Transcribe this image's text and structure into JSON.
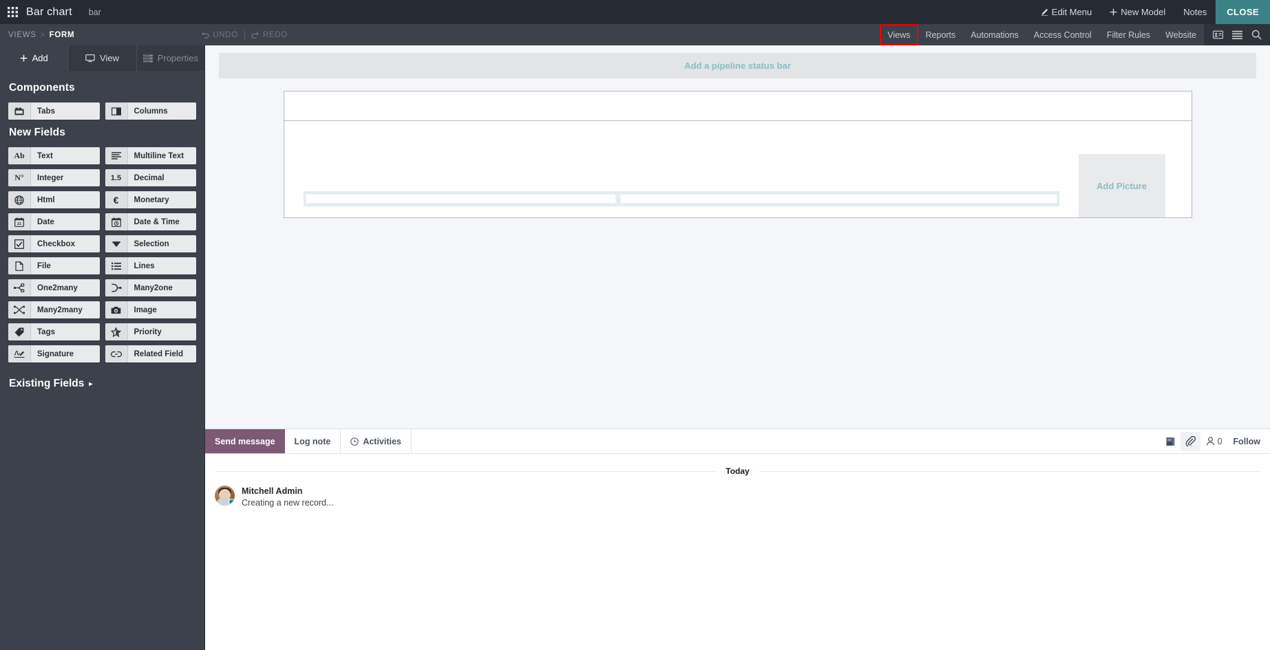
{
  "topbar": {
    "apps_icon": "apps-grid-icon",
    "title": "Bar chart",
    "subtitle": "bar",
    "edit_menu": "Edit Menu",
    "new_model": "New Model",
    "notes": "Notes",
    "close": "CLOSE",
    "close_color": "#3b8286"
  },
  "subnav": {
    "breadcrumb": {
      "root": "VIEWS",
      "separator": ">",
      "current": "FORM"
    },
    "undo": "UNDO",
    "redo": "REDO",
    "items": [
      {
        "label": "Views",
        "highlighted": true
      },
      {
        "label": "Reports",
        "highlighted": false
      },
      {
        "label": "Automations",
        "highlighted": false
      },
      {
        "label": "Access Control",
        "highlighted": false
      },
      {
        "label": "Filter Rules",
        "highlighted": false
      },
      {
        "label": "Website",
        "highlighted": false
      }
    ],
    "highlight_color": "#ee0000",
    "icons": [
      "contact-card-icon",
      "list-icon",
      "search-icon"
    ]
  },
  "sidebar": {
    "tabs": [
      {
        "label": "Add",
        "icon": "plus-icon",
        "state": "active"
      },
      {
        "label": "View",
        "icon": "monitor-icon",
        "state": "normal"
      },
      {
        "label": "Properties",
        "icon": "properties-icon",
        "state": "disabled"
      }
    ],
    "components_heading": "Components",
    "components": [
      {
        "label": "Tabs",
        "icon": "tabs-icon"
      },
      {
        "label": "Columns",
        "icon": "columns-icon"
      }
    ],
    "new_fields_heading": "New Fields",
    "new_fields": [
      {
        "label": "Text",
        "icon": "ab-icon"
      },
      {
        "label": "Multiline Text",
        "icon": "lines-text-icon"
      },
      {
        "label": "Integer",
        "icon": "number-icon"
      },
      {
        "label": "Decimal",
        "icon": "decimal-icon"
      },
      {
        "label": "Html",
        "icon": "globe-icon"
      },
      {
        "label": "Monetary",
        "icon": "euro-icon"
      },
      {
        "label": "Date",
        "icon": "calendar-icon"
      },
      {
        "label": "Date & Time",
        "icon": "calendar-clock-icon"
      },
      {
        "label": "Checkbox",
        "icon": "checkbox-icon"
      },
      {
        "label": "Selection",
        "icon": "caret-down-icon"
      },
      {
        "label": "File",
        "icon": "file-icon"
      },
      {
        "label": "Lines",
        "icon": "list-bullet-icon"
      },
      {
        "label": "One2many",
        "icon": "one2many-icon"
      },
      {
        "label": "Many2one",
        "icon": "many2one-icon"
      },
      {
        "label": "Many2many",
        "icon": "many2many-icon"
      },
      {
        "label": "Image",
        "icon": "camera-icon"
      },
      {
        "label": "Tags",
        "icon": "tag-icon"
      },
      {
        "label": "Priority",
        "icon": "star-icon"
      },
      {
        "label": "Signature",
        "icon": "signature-icon"
      },
      {
        "label": "Related Field",
        "icon": "link-icon"
      }
    ],
    "existing_fields": "Existing Fields",
    "existing_caret": "▸"
  },
  "canvas": {
    "status_bar_placeholder": "Add a pipeline status bar",
    "add_picture_placeholder": "Add Picture",
    "placeholder_color": "#8cbcc4"
  },
  "chatter": {
    "send_message": "Send message",
    "log_note": "Log note",
    "activities": "Activities",
    "activities_icon": "clock-icon",
    "right_icons": [
      "log-book-icon",
      "attachment-icon"
    ],
    "followers_icon": "person-icon",
    "followers_count": "0",
    "follow_label": "Follow",
    "send_message_color": "#7d5a74",
    "today_label": "Today",
    "messages": [
      {
        "author": "Mitchell Admin",
        "text": "Creating a new record...",
        "avatar": "user-avatar"
      }
    ]
  }
}
